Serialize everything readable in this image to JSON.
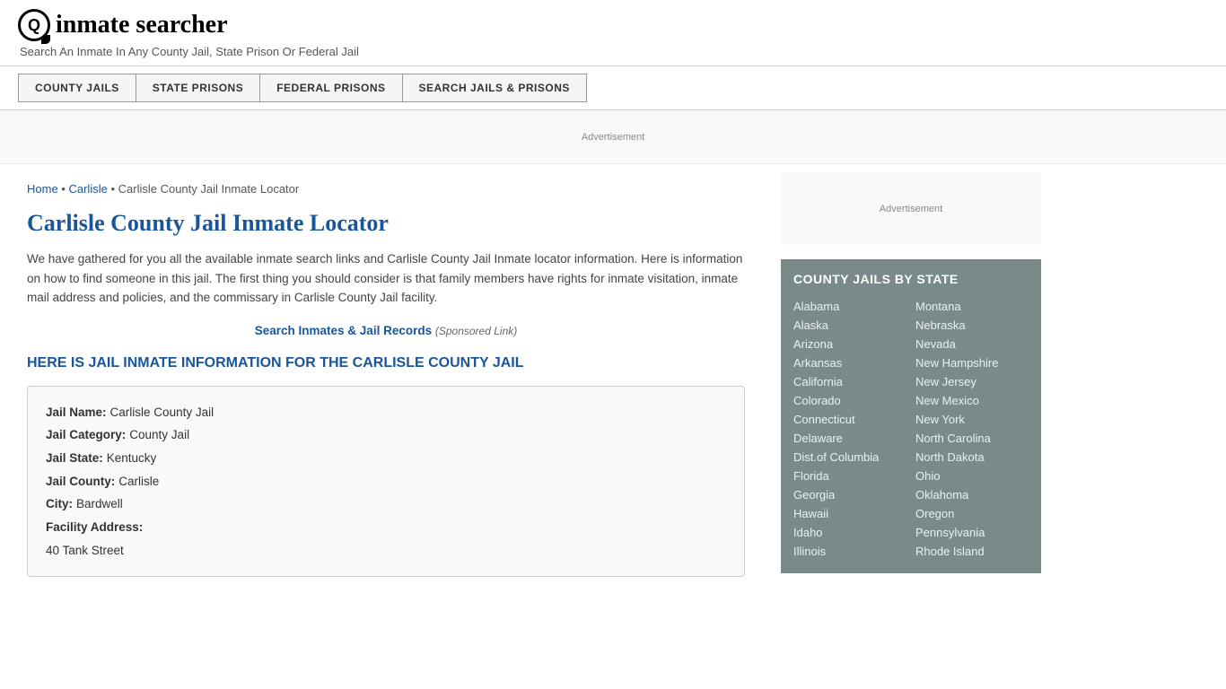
{
  "header": {
    "logo_text": "inmate searcher",
    "tagline": "Search An Inmate In Any County Jail, State Prison Or Federal Jail"
  },
  "nav": {
    "items": [
      {
        "label": "COUNTY JAILS",
        "key": "county-jails"
      },
      {
        "label": "STATE PRISONS",
        "key": "state-prisons"
      },
      {
        "label": "FEDERAL PRISONS",
        "key": "federal-prisons"
      },
      {
        "label": "SEARCH JAILS & PRISONS",
        "key": "search-jails"
      }
    ]
  },
  "ad_banner": {
    "label": "Advertisement"
  },
  "breadcrumb": {
    "home_label": "Home",
    "separator": "•",
    "carlisle_label": "Carlisle",
    "current": "Carlisle County Jail Inmate Locator"
  },
  "page": {
    "title": "Carlisle County Jail Inmate Locator",
    "intro": "We have gathered for you all the available inmate search links and Carlisle County Jail Inmate locator information. Here is information on how to find someone in this jail. The first thing you should consider is that family members have rights for inmate visitation, inmate mail address and policies, and the commissary in Carlisle County Jail facility.",
    "search_link_label": "Search Inmates & Jail Records",
    "search_link_sponsored": "(Sponsored Link)",
    "section_heading": "HERE IS JAIL INMATE INFORMATION FOR THE CARLISLE COUNTY JAIL"
  },
  "info_box": {
    "fields": [
      {
        "label": "Jail Name:",
        "value": "Carlisle County Jail"
      },
      {
        "label": "Jail Category:",
        "value": "County Jail"
      },
      {
        "label": "Jail State:",
        "value": "Kentucky"
      },
      {
        "label": "Jail County:",
        "value": "Carlisle"
      },
      {
        "label": "City:",
        "value": "Bardwell"
      },
      {
        "label": "Facility Address:",
        "value": ""
      },
      {
        "label": "",
        "value": "40 Tank Street"
      }
    ]
  },
  "sidebar": {
    "ad_label": "Advertisement",
    "state_list_title": "COUNTY JAILS BY STATE",
    "states_left": [
      "Alabama",
      "Alaska",
      "Arizona",
      "Arkansas",
      "California",
      "Colorado",
      "Connecticut",
      "Delaware",
      "Dist.of Columbia",
      "Florida",
      "Georgia",
      "Hawaii",
      "Idaho",
      "Illinois"
    ],
    "states_right": [
      "Montana",
      "Nebraska",
      "Nevada",
      "New Hampshire",
      "New Jersey",
      "New Mexico",
      "New York",
      "North Carolina",
      "North Dakota",
      "Ohio",
      "Oklahoma",
      "Oregon",
      "Pennsylvania",
      "Rhode Island"
    ]
  }
}
